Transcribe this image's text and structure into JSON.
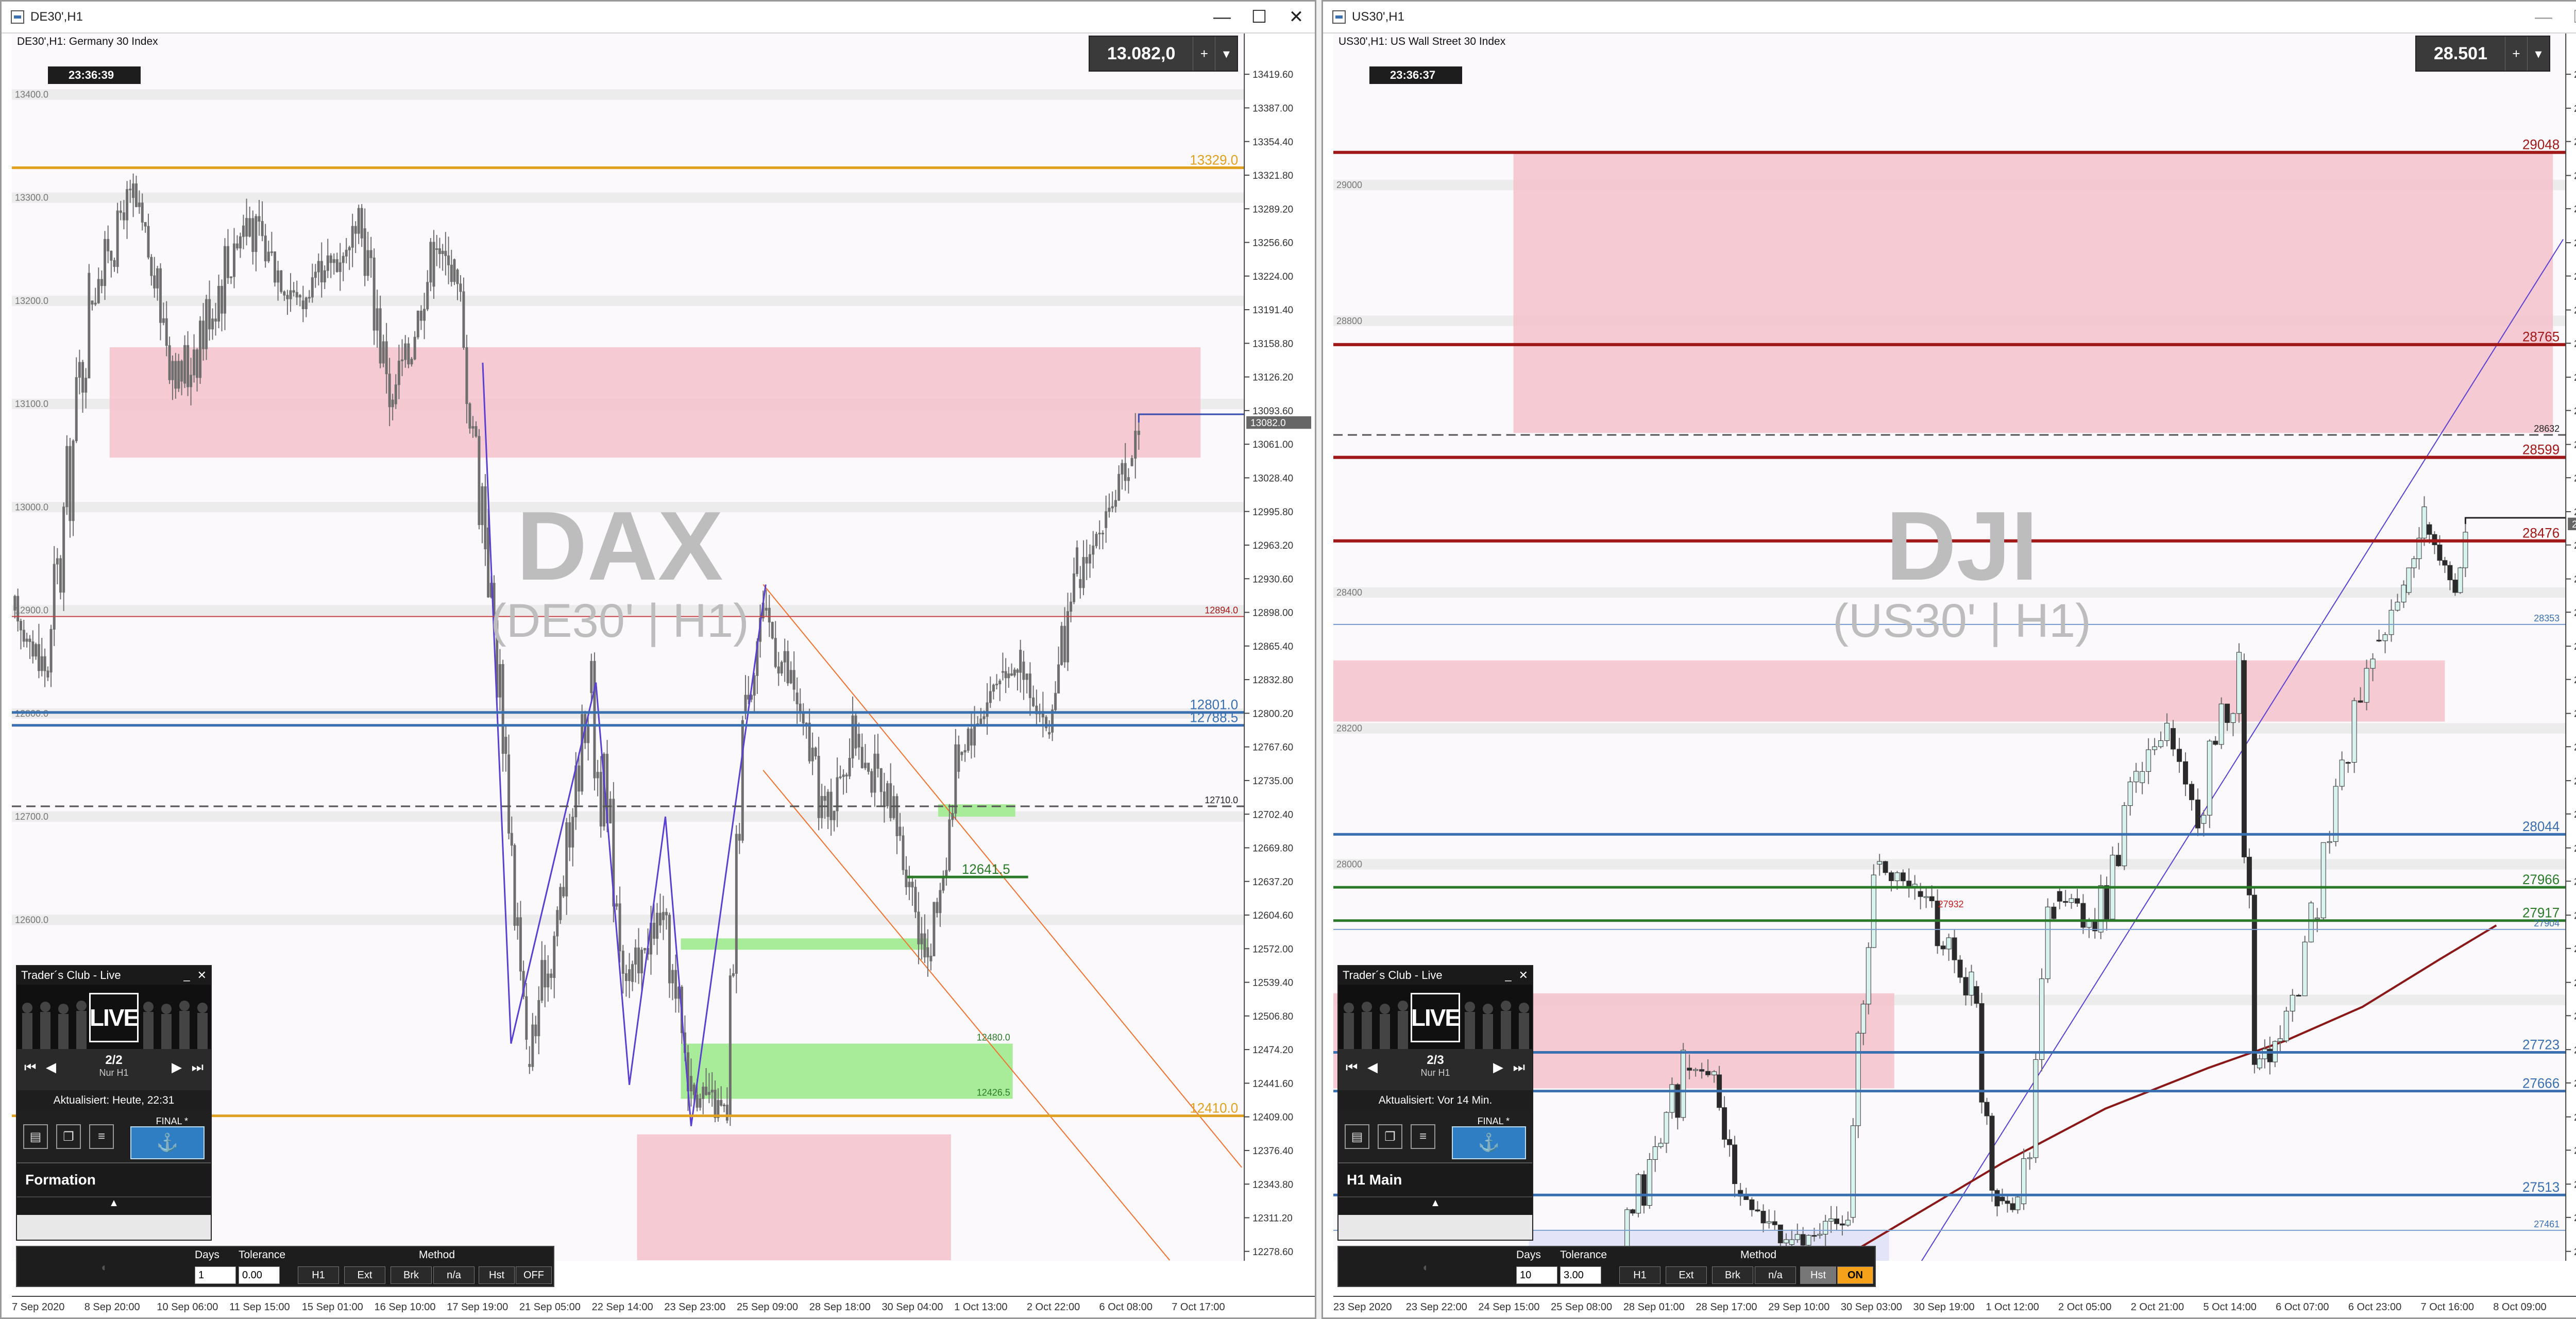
{
  "colors": {
    "zone_red": "#f4c4cd",
    "zone_green": "#a8ec9a",
    "gold": "#e0a020",
    "blue": "#3a6fb0",
    "dark_red": "#a01818",
    "candle": "#6e6e6e",
    "green": "#2a7a2a",
    "orange": "#f07030",
    "purple": "#5a3fd0"
  },
  "windows": [
    {
      "id": "left",
      "title": "DE30',H1",
      "caption": "DE30',H1:  Germany 30 Index",
      "clock": "23:36:39",
      "price_box": "13.082,0",
      "watermark_big": "DAX",
      "watermark_small": "(DE30' | H1)",
      "price_axis": [
        "13419.60",
        "13387.00",
        "13354.40",
        "13321.80",
        "13289.20",
        "13256.60",
        "13224.00",
        "13191.40",
        "13158.80",
        "13126.20",
        "13093.60",
        "13061.00",
        "13028.40",
        "12995.80",
        "12963.20",
        "12930.60",
        "12898.00",
        "12865.40",
        "12832.80",
        "12800.20",
        "12767.60",
        "12735.00",
        "12702.40",
        "12669.80",
        "12637.20",
        "12604.60",
        "12572.00",
        "12539.40",
        "12506.80",
        "12474.20",
        "12441.60",
        "12409.00",
        "12376.40",
        "12343.80",
        "12311.20",
        "12278.60"
      ],
      "inline_labels": [
        "13400.0",
        "13300.0",
        "13200.0",
        "13100.0",
        "13000.0",
        "12900.0",
        "12800.0",
        "12700.0",
        "12600.0"
      ],
      "levels": [
        {
          "label": "13329.0",
          "price": 13329.0,
          "kind": "gold"
        },
        {
          "label": "12894.0",
          "price": 12894.0,
          "kind": "thin-red"
        },
        {
          "label": "12801.0",
          "price": 12801.0,
          "kind": "blue"
        },
        {
          "label": "12788.5",
          "price": 12788.5,
          "kind": "blue"
        },
        {
          "label": "12710.0",
          "price": 12710.0,
          "kind": "dashed"
        },
        {
          "label": "12641.5",
          "price": 12641.5,
          "kind": "green"
        },
        {
          "label": "12480.0",
          "price": 12480.0,
          "kind": "zone-label"
        },
        {
          "label": "12426.5",
          "price": 12426.5,
          "kind": "zone-label"
        },
        {
          "label": "12410.0",
          "price": 12410.0,
          "kind": "gold"
        }
      ],
      "price_marker": "13082.0",
      "time_axis": [
        "7 Sep 2020",
        "8 Sep 20:00",
        "10 Sep 06:00",
        "11 Sep 15:00",
        "15 Sep 01:00",
        "16 Sep 10:00",
        "17 Sep 19:00",
        "21 Sep 05:00",
        "22 Sep 14:00",
        "23 Sep 23:00",
        "25 Sep 09:00",
        "28 Sep 18:00",
        "30 Sep 04:00",
        "1 Oct 13:00",
        "2 Oct 22:00",
        "6 Oct 08:00",
        "7 Oct 17:00"
      ],
      "widget": {
        "title": "Trader´s Club - Live",
        "banner": "LIVE",
        "page": "2/2",
        "subtitle": "Nur H1",
        "updated": "Aktualisiert: Heute, 22:31",
        "final": "FINAL *",
        "panel": "Formation",
        "min": "_",
        "close": "✕"
      }
    },
    {
      "id": "right",
      "title": "US30',H1",
      "caption": "US30',H1:  US Wall Street 30 Index",
      "clock": "23:36:37",
      "price_box": "28.501",
      "watermark_big": "DJI",
      "watermark_small": "(US30' | H1)",
      "price_axis": [
        "29163.00",
        "29113.00",
        "29064.00",
        "29014.00",
        "28965.00",
        "28915.00",
        "28866.00",
        "28816.00",
        "28767.00",
        "28717.00",
        "28668.00",
        "28618.00",
        "28569.00",
        "28519.00",
        "28470.00",
        "28420.00",
        "28371.00",
        "28321.00",
        "28272.00",
        "28222.00",
        "28173.00",
        "28123.00",
        "28074.00",
        "28024.00",
        "27975.00",
        "27925.00",
        "27876.00",
        "27826.00",
        "27777.00",
        "27727.00",
        "27678.00",
        "27628.00",
        "27579.00",
        "27529.00",
        "27480.00",
        "27430.00"
      ],
      "inline_labels": [
        "29000",
        "28800",
        "28400",
        "28200",
        "28000",
        "27800"
      ],
      "levels": [
        {
          "label": "29048",
          "price": 29048,
          "kind": "dark-red"
        },
        {
          "label": "28765",
          "price": 28765,
          "kind": "dark-red"
        },
        {
          "label": "28632",
          "price": 28632,
          "kind": "dashed"
        },
        {
          "label": "28599",
          "price": 28599,
          "kind": "dark-red"
        },
        {
          "label": "28476",
          "price": 28476,
          "kind": "dark-red"
        },
        {
          "label": "28353",
          "price": 28353,
          "kind": "thin-blue"
        },
        {
          "label": "28044",
          "price": 28044,
          "kind": "blue"
        },
        {
          "label": "27966",
          "price": 27966,
          "kind": "green"
        },
        {
          "label": "27917",
          "price": 27917,
          "kind": "green"
        },
        {
          "label": "27904",
          "price": 27904,
          "kind": "thin-blue"
        },
        {
          "label": "27932",
          "price": 27932,
          "kind": "red-text"
        },
        {
          "label": "27723",
          "price": 27723,
          "kind": "blue"
        },
        {
          "label": "27666",
          "price": 27666,
          "kind": "blue"
        },
        {
          "label": "27513",
          "price": 27513,
          "kind": "blue"
        },
        {
          "label": "27461",
          "price": 27461,
          "kind": "thin-blue"
        }
      ],
      "price_marker": "28501.00",
      "time_axis": [
        "23 Sep 2020",
        "23 Sep 22:00",
        "24 Sep 15:00",
        "25 Sep 08:00",
        "28 Sep 01:00",
        "28 Sep 17:00",
        "29 Sep 10:00",
        "30 Sep 03:00",
        "30 Sep 19:00",
        "1 Oct 12:00",
        "2 Oct 05:00",
        "2 Oct 21:00",
        "5 Oct 14:00",
        "6 Oct 07:00",
        "6 Oct 23:00",
        "7 Oct 16:00",
        "8 Oct 09:00"
      ],
      "widget": {
        "title": "Trader´s Club - Live",
        "banner": "LIVE",
        "page": "2/3",
        "subtitle": "Nur H1",
        "updated": "Aktualisiert: Vor 14 Min.",
        "final": "FINAL *",
        "panel": "H1 Main",
        "min": "_",
        "close": "✕"
      }
    }
  ],
  "fib_toolbars": [
    {
      "days_label": "Days",
      "tolerance_label": "Tolerance",
      "method_label": "Method",
      "days": "1",
      "tolerance": "0.00",
      "tf": "H1",
      "b_ext": "Ext",
      "b_brk": "Brk",
      "b_na": "n/a",
      "b_hst": "Hst",
      "b_onoff": "OFF",
      "onoff_active": false
    },
    {
      "days_label": "Days",
      "tolerance_label": "Tolerance",
      "method_label": "Method",
      "days": "10",
      "tolerance": "3.00",
      "tf": "H1",
      "b_ext": "Ext",
      "b_brk": "Brk",
      "b_na": "n/a",
      "b_hst": "Hst",
      "b_onoff": "ON",
      "onoff_active": true
    }
  ],
  "window_controls": {
    "min": "—",
    "max": "☐",
    "close": "✕"
  }
}
